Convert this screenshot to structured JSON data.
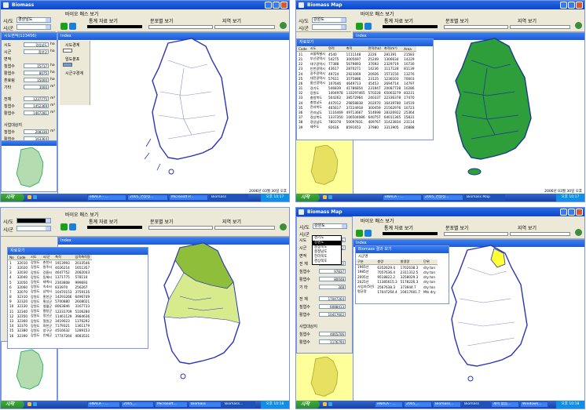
{
  "app_title": "Biomass",
  "app_title_map": "Biomass Map",
  "toolbar": {
    "sido_label": "시/도",
    "sigungu_label": "시/군",
    "sido_value_a": "경상남도",
    "sido_value_b": "강원도",
    "sido_value_d": "강원도",
    "tab_label": "바이오 매스 보기",
    "tab_label_b": "바이오 매스 보기",
    "stat_label": "통계 자료 보기",
    "distribution_label": "분포별 보기",
    "region_label": "지역 보기"
  },
  "index_panel": {
    "title": "Index",
    "items": [
      "시도경계",
      "임도분포",
      "시군구경계"
    ]
  },
  "summary_panel_title": "시도면적(123456)",
  "summary_fields": [
    {
      "label": "시도",
      "value": "경상남도"
    },
    {
      "label": "시군",
      "value": "함양군"
    },
    {
      "label": "면적",
      "value": ""
    },
    {
      "label": "침엽수",
      "value": "15717"
    },
    {
      "label": "활엽수",
      "value": "8075"
    },
    {
      "label": "혼효림",
      "value": "15000"
    },
    {
      "label": "기타",
      "value": "1000"
    }
  ],
  "summary_fields_2": [
    {
      "label": "전체",
      "value": "1237775"
    },
    {
      "label": "침엽수",
      "value": "1452369"
    },
    {
      "label": "활엽수",
      "value": "1467281"
    }
  ],
  "summary_fields_3": [
    {
      "label": "사업대상지",
      "value": ""
    },
    {
      "label": "침엽수",
      "value": "208336"
    },
    {
      "label": "활엽수",
      "value": "163364"
    }
  ],
  "units": [
    "ha",
    "ha",
    "ha",
    "ha",
    "ha",
    "m³",
    "m³",
    "m³",
    "m³",
    "m³"
  ],
  "table_b": {
    "title": "자료보기",
    "headers": [
      "Code",
      "시도",
      "면적",
      "축적",
      "면적(ha)",
      "축적(m³)",
      "Area"
    ],
    "rows": [
      [
        "11",
        "서울특별시",
        "4540",
        "1111148",
        "2226",
        "281391",
        "21583"
      ],
      [
        "21",
        "부산광역시",
        "54275",
        "3005697",
        "25249",
        "1306634",
        "14229"
      ],
      [
        "22",
        "대구광역시",
        "77388",
        "5679893",
        "37693",
        "2329719",
        "10730"
      ],
      [
        "23",
        "인천광역시",
        "43617",
        "2870271",
        "14236",
        "1117128",
        "81139"
      ],
      [
        "24",
        "광주광역시",
        "49724",
        "2923069",
        "20926",
        "1573150",
        "13276"
      ],
      [
        "25",
        "대전광역시",
        "57611",
        "3575886",
        "23125",
        "1236103",
        "70003"
      ],
      [
        "26",
        "울산광역시",
        "107646",
        "4649713",
        "45453",
        "2694714",
        "14797"
      ],
      [
        "31",
        "경기도",
        "546839",
        "41786854",
        "231947",
        "20087728",
        "10286"
      ],
      [
        "32",
        "강원도",
        "1404978",
        "133297465",
        "570228",
        "65063279",
        "83231"
      ],
      [
        "33",
        "충청북도",
        "504262",
        "38572964",
        "240337",
        "22336378",
        "17470"
      ],
      [
        "34",
        "충청남도",
        "447012",
        "29858838",
        "202070",
        "16439780",
        "14519"
      ],
      [
        "35",
        "전라북도",
        "465617",
        "37224918",
        "300459",
        "21562976",
        "10723"
      ],
      [
        "36",
        "전라남도",
        "1116469",
        "49713667",
        "514698",
        "28326922",
        "25364"
      ],
      [
        "37",
        "경상북도",
        "1337350",
        "106504086",
        "640757",
        "64011365",
        "15831"
      ],
      [
        "38",
        "경상남도",
        "780378",
        "50097831",
        "409767",
        "31423834",
        "23114"
      ],
      [
        "39",
        "제주도",
        "92616",
        "8591653",
        "37980",
        "3313905",
        "20888"
      ]
    ]
  },
  "table_c": {
    "title": "자료보기",
    "headers": [
      "No",
      "Code",
      "시도",
      "시/군",
      "축적",
      "임목축적량"
    ],
    "rows": [
      [
        "1",
        "32010",
        "강원도",
        "춘천시",
        "1913993",
        "2033546"
      ],
      [
        "2",
        "32020",
        "강원도",
        "원주시",
        "4026214",
        "1651357"
      ],
      [
        "3",
        "32030",
        "강원도",
        "강릉시",
        "4647752",
        "2082043"
      ],
      [
        "4",
        "32040",
        "강원도",
        "동해시",
        "1371775",
        "578110"
      ],
      [
        "5",
        "32050",
        "강원도",
        "태백시",
        "2303808",
        "999693"
      ],
      [
        "6",
        "32060",
        "강원도",
        "속초시",
        "833970",
        "256267"
      ],
      [
        "7",
        "32070",
        "강원도",
        "삼척시",
        "10470153",
        "3759135"
      ],
      [
        "8",
        "32310",
        "강원도",
        "홍천군",
        "14293266",
        "6496749"
      ],
      [
        "9",
        "32320",
        "강원도",
        "횡성군",
        "5700880",
        "2608021"
      ],
      [
        "10",
        "32330",
        "강원도",
        "영월군",
        "8063846",
        "3167733"
      ],
      [
        "11",
        "32340",
        "강원도",
        "평창군",
        "12231709",
        "5106280"
      ],
      [
        "12",
        "32350",
        "강원도",
        "정선군",
        "11461129",
        "3984636"
      ],
      [
        "13",
        "32360",
        "강원도",
        "철원군",
        "3419023",
        "1376292"
      ],
      [
        "14",
        "32370",
        "강원도",
        "화천군",
        "7179321",
        "1361179"
      ],
      [
        "15",
        "32380",
        "강원도",
        "양구군",
        "4516632",
        "1289153"
      ],
      [
        "16",
        "32390",
        "강원도",
        "인제군",
        "17747264",
        "4083531"
      ]
    ]
  },
  "table_d": {
    "title": "Biomass 결과 보기",
    "field": "시군명",
    "headers": [
      "구분",
      "총량",
      "발생량",
      "단위"
    ],
    "rows": [
      [
        "1965년",
        "6352629.4",
        "1702638.3",
        "dry ton"
      ],
      [
        "1985년",
        "7057636.4",
        "2311312.5",
        "dry ton"
      ],
      [
        "2005년",
        "9518822.2",
        "3258029.3",
        "dry ton"
      ],
      [
        "2025년",
        "11385615.3",
        "5178226.3",
        "dry ton"
      ],
      [
        "사업지(5년)",
        "2567638.3",
        "373944.7",
        "dry ton"
      ],
      [
        "평균량",
        "17047264.4",
        "10417601.7",
        "Mts dry"
      ]
    ]
  },
  "dropdown_d": [
    "경기도",
    "강원도",
    "충청북도",
    "충청남도",
    "전라북도",
    "경상북도"
  ],
  "fields_d": [
    {
      "label": "시도",
      "value": "강원도"
    },
    {
      "label": "시군",
      "value": "인제군"
    },
    {
      "label": "면적",
      "value": ""
    },
    {
      "label": "전 체",
      "value": "159292"
    },
    {
      "label": "침엽수",
      "value": "97837"
    },
    {
      "label": "활엽수",
      "value": "80048"
    },
    {
      "label": "기 타",
      "value": "308"
    },
    {
      "label": "전 체",
      "value": "17047264"
    },
    {
      "label": "침엽수",
      "value": "6088413"
    },
    {
      "label": "활엽수",
      "value": "10417602"
    },
    {
      "label": "사업대상지",
      "value": ""
    },
    {
      "label": "침엽수",
      "value": "4065706"
    },
    {
      "label": "활엽수",
      "value": "1176794"
    }
  ],
  "taskbar": {
    "start": "시작",
    "tasks_a": [
      "eNALA - ...",
      "2005_연말정...",
      "Microsoft P...",
      "Biomass"
    ],
    "tasks_b": [
      "eNALA - ...",
      "2005_연말정...",
      "Biomass Map"
    ],
    "tasks_c": [
      "eNALA - ...",
      "2005_...",
      "Microsoft...",
      "Biomass",
      "Biomass..."
    ],
    "tasks_d": [
      "eNALA - ...",
      "2005_...",
      "Biomass...",
      "Biomass",
      "제목 없음...",
      "Windows..."
    ],
    "clock_a": "오후 10:17",
    "clock_b": "오후 10:17",
    "clock_c": "오후 10:18",
    "clock_d": "오후 10:18"
  },
  "status_a": "2006년 03월 30일 오후",
  "status_b": "2006년 03월 30일 오후",
  "colors": {
    "title_blue": "#0a45c8",
    "panel_beige": "#ece9d8",
    "map_green": "#2e9e3a",
    "map_yellow_green": "#c8e06a",
    "highlight_yellow": "#ffff33"
  }
}
